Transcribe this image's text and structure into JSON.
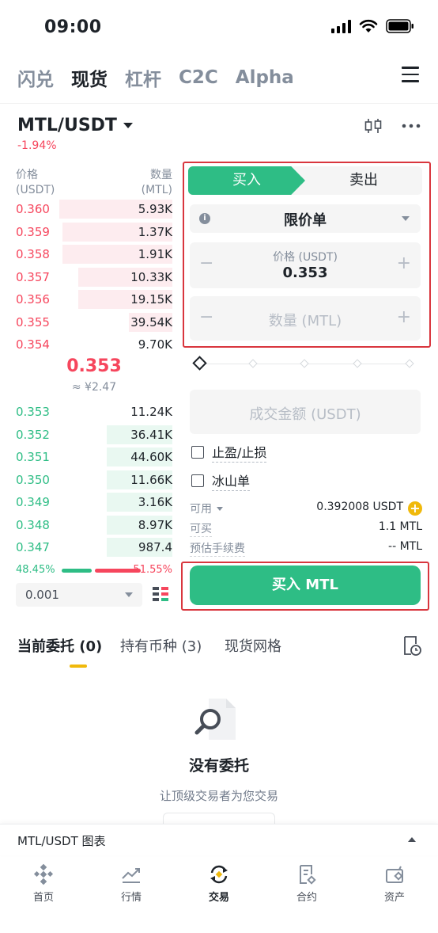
{
  "status_bar": {
    "time": "09:00"
  },
  "top_tabs": [
    {
      "label": "闪兑"
    },
    {
      "label": "现货"
    },
    {
      "label": "杠杆"
    },
    {
      "label": "C2C"
    },
    {
      "label": "Alpha"
    }
  ],
  "pair": {
    "symbol": "MTL/USDT",
    "change": "-1.94%"
  },
  "order_book": {
    "price_header": "价格",
    "price_unit": "(USDT)",
    "qty_header": "数量",
    "qty_unit": "(MTL)",
    "asks": [
      {
        "price": "0.360",
        "qty": "5.93K",
        "depth": 0.72
      },
      {
        "price": "0.359",
        "qty": "1.37K",
        "depth": 0.7
      },
      {
        "price": "0.358",
        "qty": "1.91K",
        "depth": 0.7
      },
      {
        "price": "0.357",
        "qty": "10.33K",
        "depth": 0.6
      },
      {
        "price": "0.356",
        "qty": "19.15K",
        "depth": 0.6
      },
      {
        "price": "0.355",
        "qty": "39.54K",
        "depth": 0.28
      },
      {
        "price": "0.354",
        "qty": "9.70K",
        "depth": 0.0
      }
    ],
    "last_price": "0.353",
    "last_price_cny": "≈ ¥2.47",
    "bids": [
      {
        "price": "0.353",
        "qty": "11.24K",
        "depth": 0.0
      },
      {
        "price": "0.352",
        "qty": "36.41K",
        "depth": 0.42
      },
      {
        "price": "0.351",
        "qty": "44.60K",
        "depth": 0.42
      },
      {
        "price": "0.350",
        "qty": "11.66K",
        "depth": 0.42
      },
      {
        "price": "0.349",
        "qty": "3.16K",
        "depth": 0.42
      },
      {
        "price": "0.348",
        "qty": "8.97K",
        "depth": 0.42
      },
      {
        "price": "0.347",
        "qty": "987.4",
        "depth": 0.42
      }
    ],
    "buy_ratio": "48.45%",
    "sell_ratio": "51.55%",
    "precision": "0.001"
  },
  "order_form": {
    "buy_tab": "买入",
    "sell_tab": "卖出",
    "order_type": "限价单",
    "price_label": "价格 (USDT)",
    "price_value": "0.353",
    "qty_placeholder": "数量 (MTL)",
    "total_placeholder": "成交金额 (USDT)",
    "tp_sl_label": "止盈/止损",
    "iceberg_label": "冰山单",
    "available_label": "可用",
    "available_value": "0.392008 USDT",
    "can_buy_label": "可买",
    "can_buy_value": "1.1 MTL",
    "fee_label": "预估手续费",
    "fee_value": "-- MTL",
    "buy_button": "买入 MTL"
  },
  "orders_tabs": {
    "open_orders": "当前委托 (0)",
    "holdings": "持有币种 (3)",
    "spot_grid": "现货网格"
  },
  "empty_state": {
    "title": "没有委托",
    "subtitle": "让顶级交易者为您交易"
  },
  "chart_bar": {
    "label": "MTL/USDT 图表"
  },
  "nav": [
    {
      "label": "首页",
      "icon": "home-icon"
    },
    {
      "label": "行情",
      "icon": "markets-icon"
    },
    {
      "label": "交易",
      "icon": "trade-icon"
    },
    {
      "label": "合约",
      "icon": "futures-icon"
    },
    {
      "label": "资产",
      "icon": "wallet-icon"
    }
  ],
  "colors": {
    "buy": "#2ebd85",
    "sell": "#f6465d",
    "accent": "#f0b90b",
    "highlight_box": "#d9363e"
  }
}
